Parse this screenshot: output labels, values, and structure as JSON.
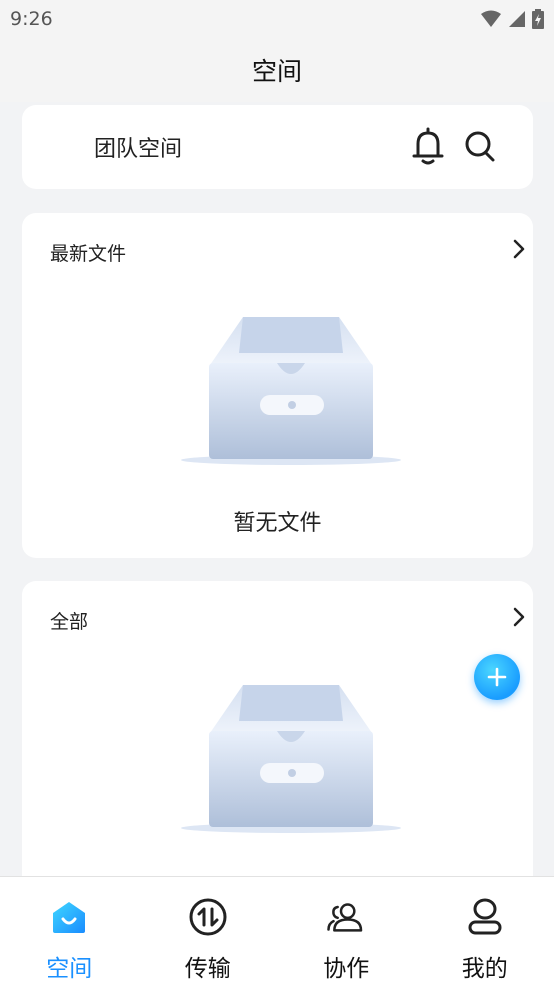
{
  "status_bar": {
    "time": "9:26"
  },
  "header": {
    "title": "空间"
  },
  "team": {
    "label": "团队空间"
  },
  "recent": {
    "title": "最新文件",
    "empty_text": "暂无文件"
  },
  "all": {
    "title": "全部"
  },
  "tabs": [
    {
      "label": "空间",
      "icon": "home-space-icon",
      "active": true
    },
    {
      "label": "传输",
      "icon": "transfer-icon",
      "active": false
    },
    {
      "label": "协作",
      "icon": "collaborate-icon",
      "active": false
    },
    {
      "label": "我的",
      "icon": "profile-icon",
      "active": false
    }
  ],
  "colors": {
    "accent": "#1a90ff",
    "background": "#f2f3f5",
    "card": "#ffffff"
  }
}
